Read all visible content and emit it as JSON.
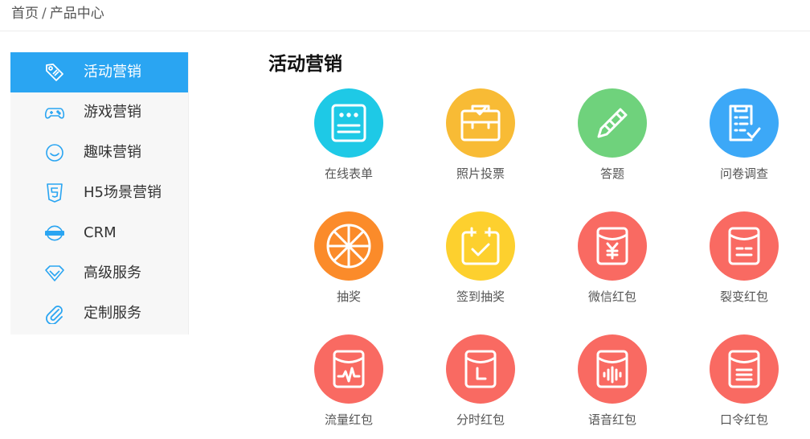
{
  "breadcrumb": {
    "home": "首页",
    "separator": "/",
    "current": "产品中心"
  },
  "sidebar": {
    "items": [
      {
        "label": "活动营销",
        "icon": "tag-icon",
        "active": true
      },
      {
        "label": "游戏营销",
        "icon": "gamepad-icon",
        "active": false
      },
      {
        "label": "趣味营销",
        "icon": "smile-icon",
        "active": false
      },
      {
        "label": "H5场景营销",
        "icon": "html5-icon",
        "active": false
      },
      {
        "label": "CRM",
        "icon": "crm-icon",
        "active": false
      },
      {
        "label": "高级服务",
        "icon": "diamond-icon",
        "active": false
      },
      {
        "label": "定制服务",
        "icon": "paperclip-icon",
        "active": false
      }
    ],
    "accent": "#2aa5f2"
  },
  "main": {
    "title": "活动营销",
    "items": [
      {
        "label": "在线表单",
        "icon": "form-icon",
        "color": "#1ec9e6"
      },
      {
        "label": "照片投票",
        "icon": "ballot-box-icon",
        "color": "#f8bb35"
      },
      {
        "label": "答题",
        "icon": "pencil-icon",
        "color": "#6fd27c"
      },
      {
        "label": "问卷调查",
        "icon": "survey-checklist-icon",
        "color": "#3ca8f7"
      },
      {
        "label": "抽奖",
        "icon": "wheel-icon",
        "color": "#fb8b2a"
      },
      {
        "label": "签到抽奖",
        "icon": "calendar-check-icon",
        "color": "#fdd02e"
      },
      {
        "label": "微信红包",
        "icon": "red-envelope-yen-icon",
        "color": "#f96a62"
      },
      {
        "label": "裂变红包",
        "icon": "red-envelope-split-icon",
        "color": "#f96a62"
      },
      {
        "label": "流量红包",
        "icon": "red-envelope-pulse-icon",
        "color": "#f96a62"
      },
      {
        "label": "分时红包",
        "icon": "red-envelope-time-icon",
        "color": "#f96a62"
      },
      {
        "label": "语音红包",
        "icon": "red-envelope-voice-icon",
        "color": "#f96a62"
      },
      {
        "label": "口令红包",
        "icon": "red-envelope-password-icon",
        "color": "#f96a62"
      }
    ]
  }
}
